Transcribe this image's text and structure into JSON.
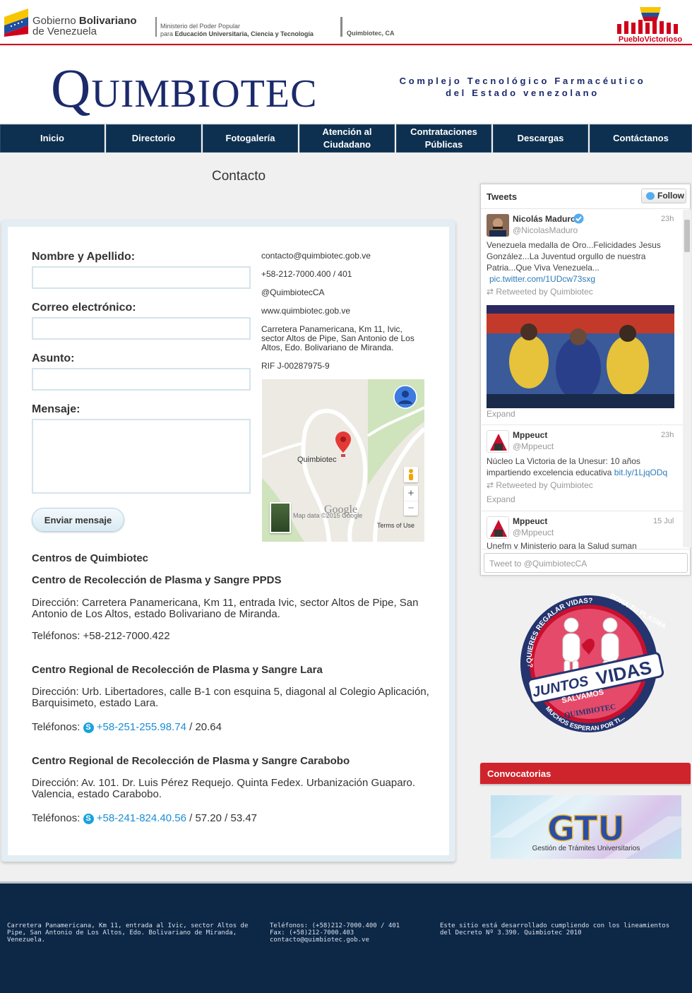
{
  "govbar": {
    "gov_line1": "Gobierno",
    "gov_line1_bold": "Bolivariano",
    "gov_line2": "de Venezuela",
    "ministry_line1": "Ministerio del Poder Popular",
    "ministry_line2_prefix": "para",
    "ministry_line2_bold": "Educación Universitaria, Ciencia y Tecnología",
    "entity": "Quimbiotec, CA",
    "pueblo_logo": "PuebloVictorioso"
  },
  "header": {
    "logo_first": "Q",
    "logo_rest": "UIMBIOTEC",
    "tagline_1": "Complejo Tecnológico Farmacéutico",
    "tagline_2": "del Estado venezolano"
  },
  "nav": [
    {
      "label": "Inicio",
      "w": 148
    },
    {
      "label": "Directorio",
      "w": 135
    },
    {
      "label": "Fotogalería",
      "w": 135
    },
    {
      "label": "Atención al Ciudadano",
      "w": 135
    },
    {
      "label": "Contrataciones Públicas",
      "w": 135
    },
    {
      "label": "Descargas",
      "w": 135
    },
    {
      "label": "Contáctanos",
      "w": 145
    }
  ],
  "page": {
    "title": "Contacto"
  },
  "form": {
    "name_label": "Nombre y Apellido:",
    "email_label": "Correo electrónico:",
    "subject_label": "Asunto:",
    "message_label": "Mensaje:",
    "submit_label": "Enviar mensaje"
  },
  "contact_info": {
    "email": "contacto@quimbiotec.gob.ve",
    "phone": "+58-212-7000.400 / 401",
    "twitter": "@QuimbiotecCA",
    "web": "www.quimbiotec.gob.ve",
    "address": "Carretera Panamericana, Km 11, Ivic, sector Altos de Pipe, San Antonio de Los Altos, Edo. Bolivariano de Miranda.",
    "rif": "RIF J-00287975-9"
  },
  "map": {
    "place_label": "Quimbiotec",
    "google_label": "Google",
    "map_data": "Map data ©2015 Google",
    "terms": "Terms of Use",
    "zoom_in": "+",
    "zoom_out": "−"
  },
  "centers": {
    "heading": "Centros de Quimbiotec",
    "items": [
      {
        "name": "Centro de Recolección de Plasma y Sangre PPDS",
        "address": "Dirección: Carretera Panamericana, Km 11, entrada Ivic, sector Altos de Pipe, San Antonio de Los Altos, estado Bolivariano de Miranda.",
        "phones_prefix": "Teléfonos: +58-212-7000.422",
        "phones_link": "",
        "phones_suffix": ""
      },
      {
        "name": "Centro Regional de Recolección de Plasma y Sangre Lara",
        "address": "Dirección: Urb. Libertadores, calle B-1 con esquina 5, diagonal al Colegio Aplicación, Barquisimeto, estado Lara.",
        "phones_prefix": "Teléfonos:",
        "phones_link": "+58-251-255.98.74",
        "phones_suffix": " / 20.64"
      },
      {
        "name": "Centro Regional de Recolección de Plasma y Sangre Carabobo",
        "address": "Dirección: Av. 101. Dr. Luis Pérez Requejo. Quinta Fedex. Urbanización Guaparo. Valencia, estado Carabobo.",
        "phones_prefix": "Teléfonos:",
        "phones_link": "+58-241-824.40.56",
        "phones_suffix": " / 57.20 / 53.47"
      }
    ]
  },
  "tweets": {
    "title": "Tweets",
    "follow": "Follow",
    "input_placeholder": "Tweet to @QuimbiotecCA",
    "items": [
      {
        "name": "Nicolás Maduro",
        "handle": "@NicolasMaduro",
        "time": "23h",
        "text": "Venezuela medalla de Oro...Felicidades Jesus González...La Juventud orgullo de nuestra Patria...Que Viva Venezuela...",
        "link": "pic.twitter.com/1UDcw73sxg",
        "retweeted": "Retweeted by Quimbiotec",
        "expand": "Expand"
      },
      {
        "name": "Mppeuct",
        "handle": "@Mppeuct",
        "time": "23h",
        "text": "Núcleo La Victoria de la Unesur: 10 años impartiendo excelencia educativa",
        "link": "bit.ly/1LjqODq",
        "retweeted": "Retweeted by Quimbiotec",
        "expand": "Expand"
      },
      {
        "name": "Mppeuct",
        "handle": "@Mppeuct",
        "time": "15 Jul",
        "text": "Unefm y Ministerio para la Salud suman"
      }
    ]
  },
  "campaign": {
    "top_left": "¿QUIERES REGALAR VIDAS?",
    "top_right": "DONA TU PLASMA",
    "juntos": "JUNTOS",
    "salvamos": "SALVAMOS",
    "vidas": "VIDAS",
    "brand": "QUIMBIOTEC",
    "bottom": "MUCHOS ESPERAN POR TI...",
    "colors": {
      "red": "#c8102e",
      "navy": "#24346e"
    }
  },
  "convocatorias": {
    "title": "Convocatorias",
    "gtu_logo": "GTU",
    "gtu_caption": "Gestión de Trámites Universitarios"
  },
  "footer": {
    "address": "Carretera Panamericana, Km 11, entrada al Ivic, sector Altos de Pipe, San Antonio de Los Altos, Edo. Bolivariano de Miranda, Venezuela.",
    "phones": "Teléfonos: (+58)212-7000.400 / 401",
    "fax": "Fax: (+58)212-7000.403",
    "email": "contacto@quimbiotec.gob.ve",
    "legal": "Este sitio está desarrollado cumpliendo con los lineamientos del Decreto Nº 3.390. Quimbiotec 2010"
  },
  "colors": {
    "nav_bg": "#0d3050",
    "brand_navy": "#1b2a6b",
    "accent_red": "#d0242c",
    "link_blue": "#1a8dd6",
    "footer_bg": "#0d2747"
  }
}
